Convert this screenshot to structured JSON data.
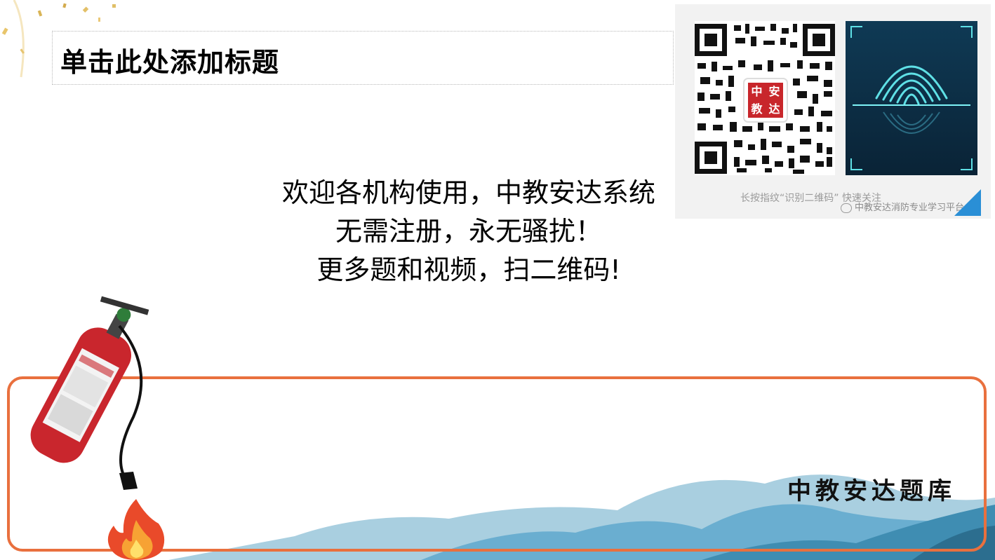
{
  "slide": {
    "title": "单击此处添加标题",
    "body_lines": [
      "欢迎各机构使用，中教安达系统",
      "无需注册，永无骚扰！",
      "更多题和视频，扫二维码!"
    ],
    "qr": {
      "logo_chars": [
        "中",
        "安",
        "教",
        "达"
      ],
      "caption": "长按指纹“识别二维码” 快速关注",
      "watermark": "中教安达消防专业学习平台"
    },
    "footer_brand": "中教安达题库"
  },
  "colors": {
    "accent_frame": "#e9703e",
    "mountain_light": "#a9cfe0",
    "mountain_dark": "#3f8db2",
    "qr_logo": "#c8262b",
    "extinguisher": "#c9262d"
  },
  "icons": [
    "confetti-decoration",
    "fire-extinguisher-illustration",
    "flame-icon",
    "fingerprint-icon",
    "wechat-icon",
    "mountains-decoration"
  ]
}
